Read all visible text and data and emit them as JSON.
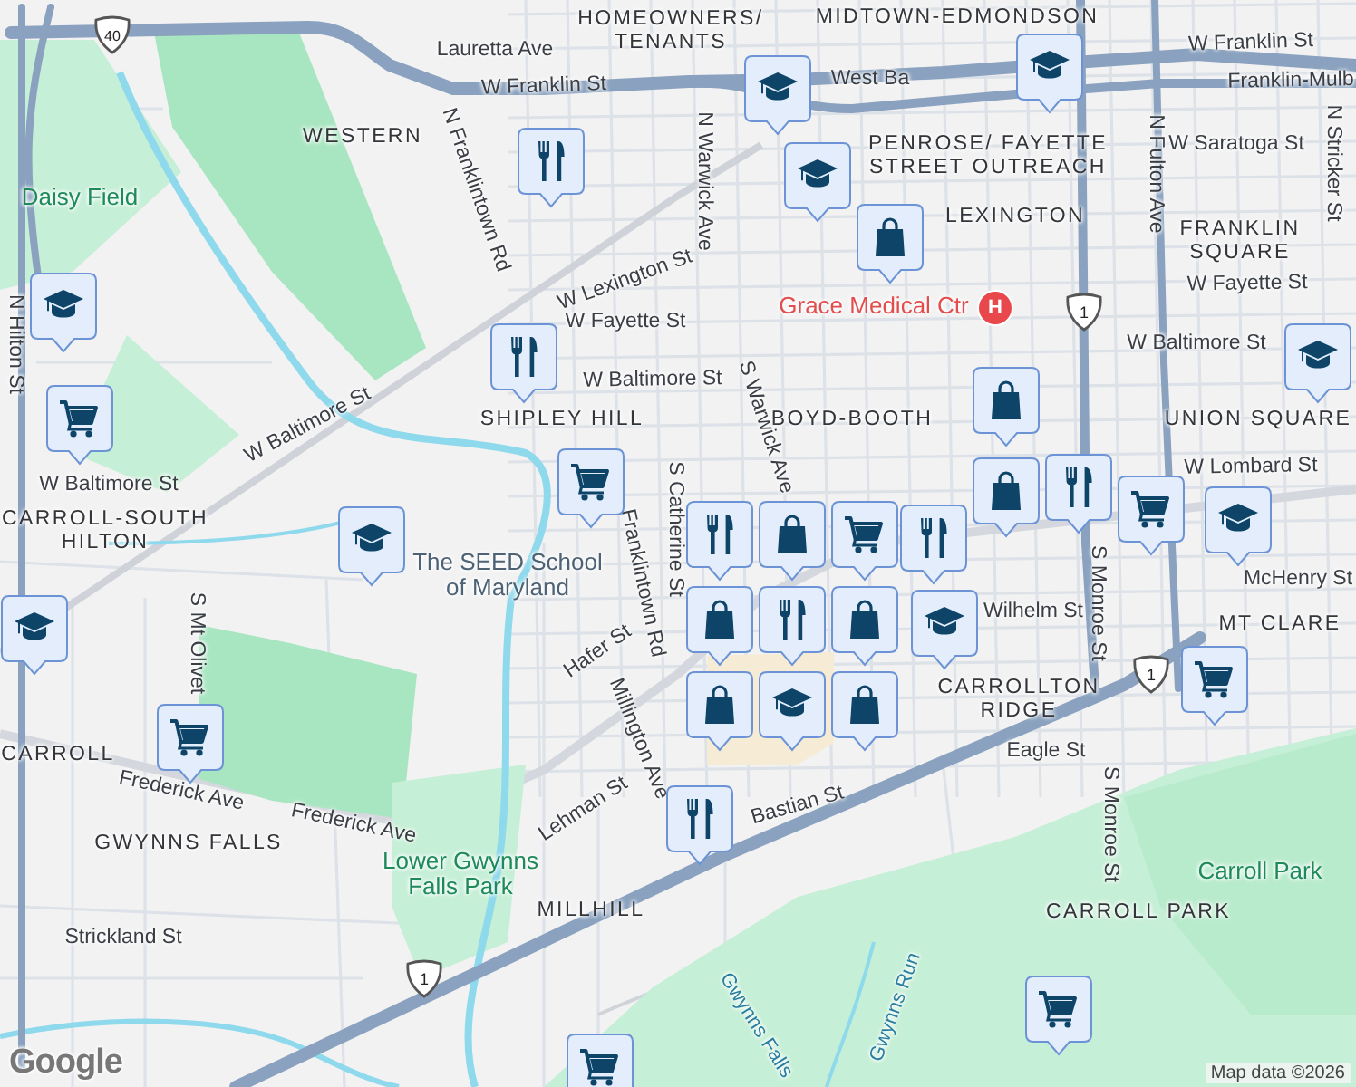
{
  "labels": [
    {
      "text": "HOMEOWNERS/ TENANTS",
      "kind": "neighborhood"
    },
    {
      "text": "MIDTOWN-EDMONDSON",
      "kind": "neighborhood"
    },
    {
      "text": "Lauretta Ave",
      "kind": "street"
    },
    {
      "text": "W Franklin St",
      "kind": "street"
    },
    {
      "text": "W Franklin St",
      "kind": "street"
    },
    {
      "text": "West Ba",
      "kind": "street"
    },
    {
      "text": "Franklin-Mulb",
      "kind": "street"
    },
    {
      "text": "WESTERN",
      "kind": "neighborhood"
    },
    {
      "text": "N Franklintown Rd",
      "kind": "street"
    },
    {
      "text": "N Warwick Ave",
      "kind": "street"
    },
    {
      "text": "PENROSE/ FAYETTE STREET OUTREACH",
      "kind": "neighborhood"
    },
    {
      "text": "LEXINGTON",
      "kind": "neighborhood"
    },
    {
      "text": "W Saratoga St",
      "kind": "street"
    },
    {
      "text": "N Fulton Ave",
      "kind": "street"
    },
    {
      "text": "N Stricker St",
      "kind": "street"
    },
    {
      "text": "FRANKLIN SQUARE",
      "kind": "neighborhood"
    },
    {
      "text": "Daisy Field",
      "kind": "park"
    },
    {
      "text": "N Hilton St",
      "kind": "street"
    },
    {
      "text": "W Lexington St",
      "kind": "street"
    },
    {
      "text": "W Fayette St",
      "kind": "street"
    },
    {
      "text": "Grace Medical Ctr",
      "kind": "hospital"
    },
    {
      "text": "W Fayette St",
      "kind": "street"
    },
    {
      "text": "SHIPLEY HILL",
      "kind": "neighborhood"
    },
    {
      "text": "W Baltimore St",
      "kind": "street"
    },
    {
      "text": "W Baltimore St",
      "kind": "street"
    },
    {
      "text": "W Baltimore St",
      "kind": "street"
    },
    {
      "text": "W Baltimore St",
      "kind": "street"
    },
    {
      "text": "BOYD-BOOTH",
      "kind": "neighborhood"
    },
    {
      "text": "UNION SQUARE",
      "kind": "neighborhood"
    },
    {
      "text": "W Lombard St",
      "kind": "street"
    },
    {
      "text": "CARROLL-SOUTH HILTON",
      "kind": "neighborhood"
    },
    {
      "text": "The SEED School of Maryland",
      "kind": "poi"
    },
    {
      "text": "S Warwick Ave",
      "kind": "street"
    },
    {
      "text": "S Catherine St",
      "kind": "street"
    },
    {
      "text": "Franklintown Rd",
      "kind": "street"
    },
    {
      "text": "Hafer St",
      "kind": "street"
    },
    {
      "text": "Millington Ave",
      "kind": "street"
    },
    {
      "text": "Lehman St",
      "kind": "street"
    },
    {
      "text": "S Mt Olivet",
      "kind": "street"
    },
    {
      "text": "CARROLL",
      "kind": "neighborhood"
    },
    {
      "text": "Frederick Ave",
      "kind": "street"
    },
    {
      "text": "Frederick Ave",
      "kind": "street"
    },
    {
      "text": "GWYNNS FALLS",
      "kind": "neighborhood"
    },
    {
      "text": "Lower Gwynns Falls Park",
      "kind": "park"
    },
    {
      "text": "MILLHILL",
      "kind": "neighborhood"
    },
    {
      "text": "Strickland St",
      "kind": "street"
    },
    {
      "text": "McHenry St",
      "kind": "street"
    },
    {
      "text": "MT CLARE",
      "kind": "neighborhood"
    },
    {
      "text": "Wilhelm St",
      "kind": "street"
    },
    {
      "text": "CARROLLTON RIDGE",
      "kind": "neighborhood"
    },
    {
      "text": "S Monroe St",
      "kind": "street"
    },
    {
      "text": "S Monroe St",
      "kind": "street"
    },
    {
      "text": "Eagle St",
      "kind": "street"
    },
    {
      "text": "Bastian St",
      "kind": "street"
    },
    {
      "text": "Carroll Park",
      "kind": "park"
    },
    {
      "text": "CARROLL PARK",
      "kind": "neighborhood"
    },
    {
      "text": "Gwynns Run",
      "kind": "water"
    },
    {
      "text": "Gwynns Falls",
      "kind": "water"
    }
  ],
  "route_shields": [
    {
      "text": "40"
    },
    {
      "text": "1"
    },
    {
      "text": "1"
    },
    {
      "text": "1"
    }
  ],
  "hospital_marker": {
    "symbol": "H"
  },
  "pins": [
    {
      "kind": "restaurant"
    },
    {
      "kind": "school"
    },
    {
      "kind": "grocery"
    },
    {
      "kind": "restaurant"
    },
    {
      "kind": "grocery"
    },
    {
      "kind": "school"
    },
    {
      "kind": "school"
    },
    {
      "kind": "school"
    },
    {
      "kind": "school"
    },
    {
      "kind": "shopping"
    },
    {
      "kind": "shopping"
    },
    {
      "kind": "school"
    },
    {
      "kind": "restaurant"
    },
    {
      "kind": "grocery"
    },
    {
      "kind": "restaurant"
    },
    {
      "kind": "shopping"
    },
    {
      "kind": "restaurant"
    },
    {
      "kind": "shopping"
    },
    {
      "kind": "grocery"
    },
    {
      "kind": "shopping"
    },
    {
      "kind": "restaurant"
    },
    {
      "kind": "school"
    },
    {
      "kind": "shopping"
    },
    {
      "kind": "shopping"
    },
    {
      "kind": "school"
    },
    {
      "kind": "grocery"
    },
    {
      "kind": "school"
    },
    {
      "kind": "school"
    },
    {
      "kind": "grocery"
    },
    {
      "kind": "shopping"
    },
    {
      "kind": "restaurant"
    },
    {
      "kind": "grocery"
    },
    {
      "kind": "grocery"
    }
  ],
  "logo": "Google",
  "attribution": "Map data ©2026"
}
